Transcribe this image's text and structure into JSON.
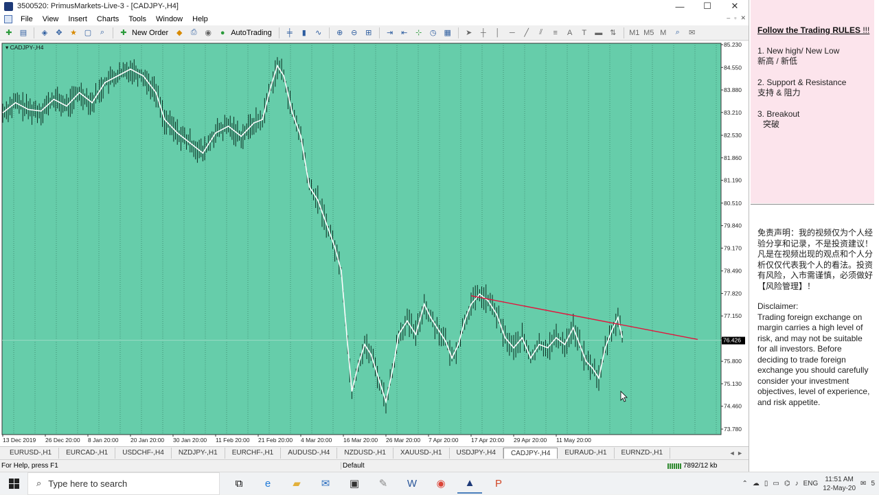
{
  "window": {
    "title": "3500520: PrimusMarkets-Live-3 - [CADJPY-,H4]",
    "minimize": "—",
    "maximize": "☐",
    "close": "✕"
  },
  "menu": {
    "items": [
      "File",
      "View",
      "Insert",
      "Charts",
      "Tools",
      "Window",
      "Help"
    ],
    "mdi_minimize": "–",
    "mdi_restore": "▫",
    "mdi_close": "✕"
  },
  "toolbar": {
    "new_order": "New Order",
    "auto_trading": "AutoTrading",
    "timeframes": [
      "M1",
      "M5",
      "M"
    ]
  },
  "chart": {
    "symbol_label": "CADJPY-,H4",
    "background": "#66cdaa",
    "grid_color": "#2b6a55",
    "price_line_color": "#ffffff",
    "trendline_color": "#e3143c",
    "current_price": "76.426",
    "price_ticks": [
      "85.230",
      "84.550",
      "83.880",
      "83.210",
      "82.530",
      "81.860",
      "81.190",
      "80.510",
      "79.840",
      "79.170",
      "78.490",
      "77.820",
      "77.150",
      "76.470",
      "75.800",
      "75.130",
      "74.460",
      "73.780"
    ],
    "date_ticks": [
      "13 Dec 2019",
      "26 Dec 20:00",
      "8 Jan 20:00",
      "20 Jan 20:00",
      "30 Jan 20:00",
      "11 Feb 20:00",
      "21 Feb 20:00",
      "4 Mar 20:00",
      "16 Mar 20:00",
      "26 Mar 20:00",
      "7 Apr 20:00",
      "17 Apr 20:00",
      "29 Apr 20:00",
      "11 May 20:00"
    ]
  },
  "chart_data": {
    "type": "line",
    "title": "CADJPY-,H4",
    "xlabel": "",
    "ylabel": "",
    "ylim": [
      73.78,
      85.23
    ],
    "grid": true,
    "categories": [
      "13 Dec 2019",
      "26 Dec 20:00",
      "8 Jan 20:00",
      "20 Jan 20:00",
      "30 Jan 20:00",
      "11 Feb 20:00",
      "21 Feb 20:00",
      "4 Mar 20:00",
      "16 Mar 20:00",
      "26 Mar 20:00",
      "7 Apr 20:00",
      "17 Apr 20:00",
      "29 Apr 20:00",
      "11 May 20:00"
    ],
    "series": [
      {
        "name": "CADJPY-",
        "points": [
          [
            0,
            83.2
          ],
          [
            0.3,
            83.5
          ],
          [
            0.6,
            83.3
          ],
          [
            0.9,
            83.25
          ],
          [
            1.2,
            83.6
          ],
          [
            1.5,
            83.4
          ],
          [
            1.8,
            83.8
          ],
          [
            2.1,
            83.5
          ],
          [
            2.4,
            84.1
          ],
          [
            2.7,
            84.3
          ],
          [
            3.0,
            84.5
          ],
          [
            3.3,
            84.3
          ],
          [
            3.6,
            83.8
          ],
          [
            3.8,
            83.0
          ],
          [
            4.1,
            82.6
          ],
          [
            4.4,
            82.3
          ],
          [
            4.7,
            82.0
          ],
          [
            5.0,
            82.6
          ],
          [
            5.3,
            82.8
          ],
          [
            5.6,
            82.5
          ],
          [
            5.9,
            82.9
          ],
          [
            6.1,
            83.0
          ],
          [
            6.3,
            84.0
          ],
          [
            6.45,
            84.6
          ],
          [
            6.6,
            84.3
          ],
          [
            6.8,
            83.2
          ],
          [
            7.0,
            82.5
          ],
          [
            7.2,
            81.0
          ],
          [
            7.4,
            80.6
          ],
          [
            7.6,
            79.9
          ],
          [
            7.8,
            79.2
          ],
          [
            7.95,
            78.5
          ],
          [
            8.1,
            76.3
          ],
          [
            8.2,
            74.9
          ],
          [
            8.35,
            75.7
          ],
          [
            8.5,
            76.3
          ],
          [
            8.65,
            76.0
          ],
          [
            8.85,
            75.2
          ],
          [
            9.0,
            74.6
          ],
          [
            9.15,
            75.5
          ],
          [
            9.3,
            76.6
          ],
          [
            9.5,
            77.0
          ],
          [
            9.7,
            76.6
          ],
          [
            9.9,
            77.5
          ],
          [
            10.05,
            77.1
          ],
          [
            10.2,
            76.8
          ],
          [
            10.4,
            76.4
          ],
          [
            10.55,
            75.9
          ],
          [
            10.7,
            76.3
          ],
          [
            10.85,
            77.0
          ],
          [
            11.0,
            77.5
          ],
          [
            11.2,
            77.8
          ],
          [
            11.4,
            77.6
          ],
          [
            11.6,
            77.2
          ],
          [
            11.8,
            76.5
          ],
          [
            12.0,
            76.2
          ],
          [
            12.2,
            76.5
          ],
          [
            12.4,
            75.9
          ],
          [
            12.6,
            76.3
          ],
          [
            12.8,
            76.2
          ],
          [
            13.0,
            76.5
          ],
          [
            13.2,
            76.3
          ],
          [
            13.4,
            76.8
          ],
          [
            13.55,
            76.3
          ],
          [
            13.7,
            75.8
          ],
          [
            13.85,
            75.6
          ],
          [
            14.0,
            75.3
          ],
          [
            14.15,
            76.2
          ],
          [
            14.3,
            76.7
          ],
          [
            14.45,
            77.1
          ],
          [
            14.55,
            76.5
          ]
        ]
      }
    ],
    "trendline": {
      "from": [
        11.0,
        77.75
      ],
      "to": [
        16.0,
        76.45
      ]
    }
  },
  "tabs": {
    "items": [
      "EURUSD-,H1",
      "EURCAD-,H1",
      "USDCHF-,H4",
      "NZDJPY-,H1",
      "EURCHF-,H1",
      "AUDUSD-,H4",
      "NZDUSD-,H1",
      "XAUUSD-,H1",
      "USDJPY-,H4",
      "CADJPY-,H4",
      "EURAUD-,H1",
      "EURNZD-,H1"
    ],
    "active": "CADJPY-,H4",
    "arrows": "◄ ►"
  },
  "status": {
    "help": "For Help, press F1",
    "profile": "Default",
    "traffic": "7892/12 kb"
  },
  "side_panel": {
    "rules_title": "Follow the Trading RULES",
    "rules_excl": " !!!",
    "rules": [
      {
        "en": "1. New high/ New Low",
        "cn": "新高 / 新低"
      },
      {
        "en": "2. Support & Resistance",
        "cn": "支持 & 阻力"
      },
      {
        "en": "3. Breakout",
        "cn": "突破"
      }
    ],
    "disclaimer_cn": "免责声明：我的视频仅为个人经验分享和记录，不是投资建议！凡是在视频出现的观点和个人分析仅仅代表我个人的看法。投资有风险，入市需谨慎，必须做好【风险管理】！",
    "disclaimer_title": "Disclaimer:",
    "disclaimer_en": "Trading foreign exchange on margin carries a high level of risk, and may not be suitable for all investors. Before deciding to trade foreign exchange you should carefully consider your investment objectives, level of experience, and risk appetite."
  },
  "taskbar": {
    "search_placeholder": "Type here to search",
    "lang": "ENG",
    "time": "11:51 AM",
    "date": "12-May-20",
    "notif_count": "5"
  }
}
